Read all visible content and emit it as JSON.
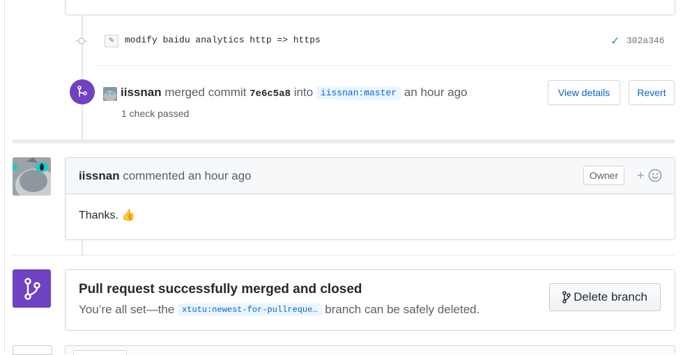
{
  "commit": {
    "icon": "commit-node-icon",
    "message": "modify baidu analytics http => https",
    "status_icon": "check-icon",
    "sha": "302a346"
  },
  "merge_event": {
    "author": "iissnan",
    "merged_text": "merged commit",
    "sha": "7e6c5a8",
    "into_text": "into",
    "branch": "iissnan:master",
    "time": "an hour ago",
    "checks": "1 check passed",
    "view_details_label": "View details",
    "revert_label": "Revert"
  },
  "comment": {
    "author": "iissnan",
    "action": "commented an hour ago",
    "badge": "Owner",
    "reaction_label": "+",
    "body": "Thanks. 👍"
  },
  "merge_status": {
    "title": "Pull request successfully merged and closed",
    "desc_prefix": "You’re all set—the",
    "branch": "xtutu:newest-for-pullreque…",
    "desc_suffix": "branch can be safely deleted.",
    "delete_label": "Delete branch"
  },
  "colors": {
    "merged_purple": "#6f42c1",
    "link_blue": "#0366d6",
    "success_green": "#28a745"
  }
}
